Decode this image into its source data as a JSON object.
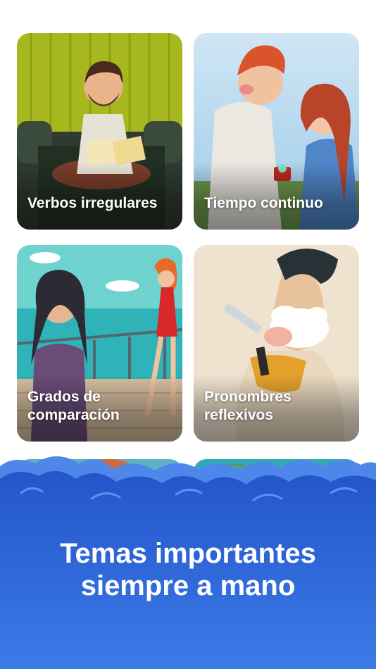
{
  "cards": [
    {
      "label": "Verbos irregulares",
      "illustration": "man-reading-on-sofa"
    },
    {
      "label": "Tiempo continuo",
      "illustration": "couple-with-ring"
    },
    {
      "label": "Grados de\ncomparación",
      "illustration": "women-on-ship-deck"
    },
    {
      "label": "Pronombres\nreflexivos",
      "illustration": "man-shaving"
    }
  ],
  "banner": {
    "line1": "Temas importantes",
    "line2": "siempre a mano"
  },
  "colors": {
    "brand_blue": "#2a5cd4",
    "cloud_blue": "#3d7ae6",
    "text_white": "#ffffff"
  }
}
